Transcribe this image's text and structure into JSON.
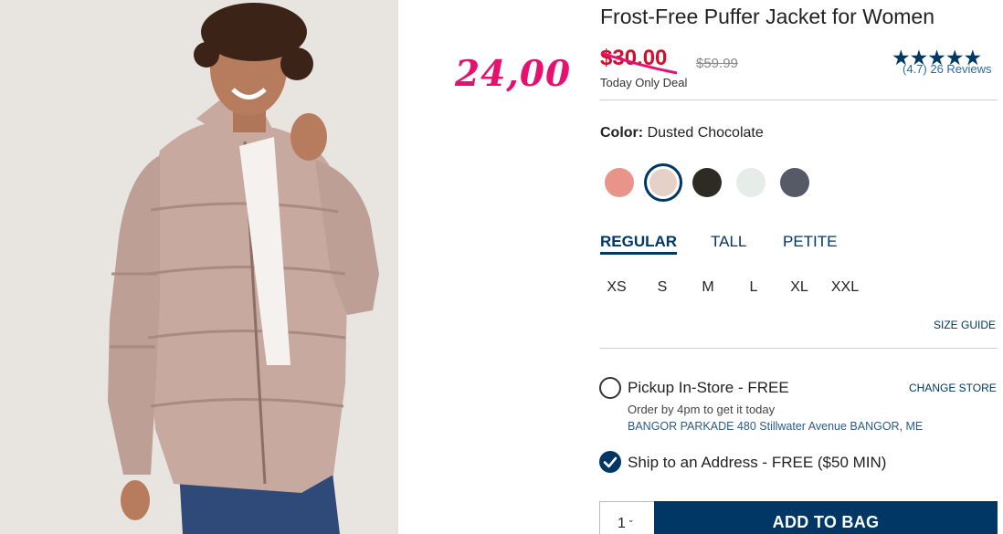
{
  "product": {
    "title": "Frost-Free Puffer Jacket for Women",
    "sale_price": "$30.00",
    "original_price": "$59.99",
    "deal_label": "Today Only Deal",
    "rating_stars": "★★★★★",
    "reviews": "(4.7) 26 Reviews",
    "rating": 4.7
  },
  "annotation": {
    "text": "24,00",
    "color": "#e6106f"
  },
  "color": {
    "label": "Color:",
    "value": "Dusted Chocolate",
    "swatches": [
      {
        "name": "coral",
        "hex": "#e8948a",
        "selected": false
      },
      {
        "name": "dusted-chocolate",
        "hex": "#e6d1c8",
        "selected": true
      },
      {
        "name": "black",
        "hex": "#2e2a24",
        "selected": false
      },
      {
        "name": "white",
        "hex": "#e6ece8",
        "selected": false
      },
      {
        "name": "charcoal",
        "hex": "#555a66",
        "selected": false
      }
    ]
  },
  "fits": [
    "REGULAR",
    "TALL",
    "PETITE"
  ],
  "sizes": [
    "XS",
    "S",
    "M",
    "L",
    "XL",
    "XXL"
  ],
  "size_guide": "SIZE GUIDE",
  "pickup": {
    "label": "Pickup In-Store - FREE",
    "change_store": "CHANGE STORE",
    "order_by": "Order by 4pm to get it today",
    "store": "BANGOR PARKADE 480 Stillwater Avenue  BANGOR, ME"
  },
  "ship": {
    "label": "Ship to an Address - FREE ($50 MIN)"
  },
  "cart": {
    "quantity": "1",
    "add_label": "ADD TO BAG"
  },
  "colors": {
    "brand_navy": "#003764",
    "sale_red": "#d30f2b"
  }
}
